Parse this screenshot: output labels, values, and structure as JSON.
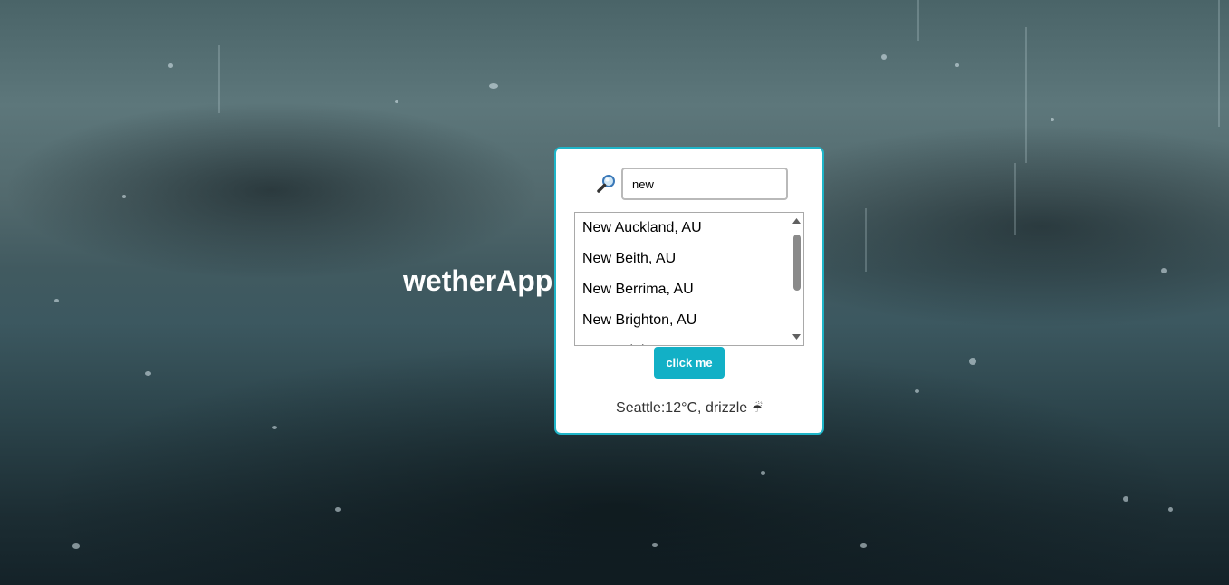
{
  "app": {
    "title": "wetherApp"
  },
  "search": {
    "value": "new",
    "icon": "magnifier-icon"
  },
  "suggestions": [
    "New Auckland, AU",
    "New Beith, AU",
    "New Berrima, AU",
    "New Brighton, AU",
    "New Brighton, AU"
  ],
  "button": {
    "label": "click me"
  },
  "weather": {
    "city": "Seattle",
    "text": "Seattle:12°C, drizzle",
    "icon": "☔",
    "icon_name": "umbrella-rain-icon"
  },
  "colors": {
    "accent": "#12b0c6",
    "card_border": "#1fb5c8"
  }
}
